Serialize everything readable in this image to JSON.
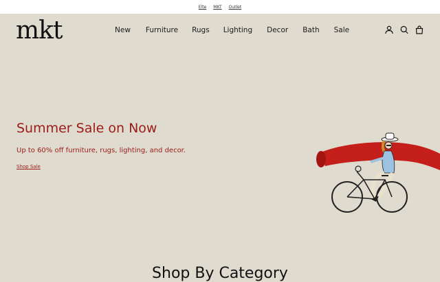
{
  "topbar": {
    "links": [
      "Elte",
      "MKT",
      "Outlet"
    ]
  },
  "brand": {
    "logo": "mkt"
  },
  "nav": {
    "items": [
      "New",
      "Furniture",
      "Rugs",
      "Lighting",
      "Decor",
      "Bath",
      "Sale"
    ]
  },
  "header_icons": [
    "account-icon",
    "search-icon",
    "bag-icon"
  ],
  "hero": {
    "title": "Summer Sale on Now",
    "subtitle": "Up to 60% off furniture, rugs, lighting, and decor.",
    "cta": "Shop Sale"
  },
  "section": {
    "heading": "Shop By Category"
  },
  "colors": {
    "background": "#e0dbcf",
    "accent": "#9a1b17",
    "topbar": "#ffffff"
  }
}
